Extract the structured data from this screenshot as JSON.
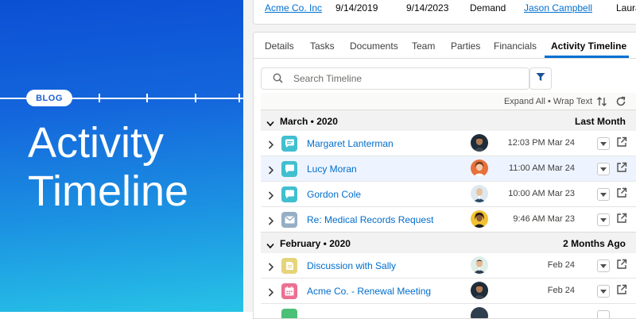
{
  "hero": {
    "tag": "BLOG",
    "title_line1": "Activity",
    "title_line2": "Timeline"
  },
  "record": {
    "account": "Acme Co. Inc",
    "date_opened": "9/14/2019",
    "date_due": "9/14/2023",
    "type": "Demand",
    "owner": "Jason Campbell",
    "last": "Laura"
  },
  "tabs": [
    {
      "label": "Details"
    },
    {
      "label": "Tasks"
    },
    {
      "label": "Documents"
    },
    {
      "label": "Team"
    },
    {
      "label": "Parties"
    },
    {
      "label": "Financials"
    },
    {
      "label": "Activity Timeline",
      "active": true
    }
  ],
  "search": {
    "placeholder": "Search Timeline"
  },
  "toolbar": {
    "expand_wrap": "Expand All • Wrap Text"
  },
  "sections": [
    {
      "label": "March • 2020",
      "right": "Last Month",
      "items": [
        {
          "subject": "Margaret Lanterman",
          "date": "12:03 PM Mar 24",
          "icon": "chat-icon",
          "color": "#40bfcf"
        },
        {
          "subject": "Lucy Moran",
          "date": "11:00 AM Mar 24",
          "icon": "chat-icon",
          "color": "#40bfcf"
        },
        {
          "subject": "Gordon Cole",
          "date": "10:00 AM Mar 23",
          "icon": "chat-icon",
          "color": "#40bfcf"
        },
        {
          "subject": "Re: Medical Records Request",
          "date": "9:46 AM Mar 23",
          "icon": "email-icon",
          "color": "#95aec5"
        }
      ]
    },
    {
      "label": "February • 2020",
      "right": "2 Months Ago",
      "items": [
        {
          "subject": "Discussion with Sally",
          "date": "Feb 24",
          "icon": "note-icon",
          "color": "#e6d478"
        },
        {
          "subject": "Acme Co. - Renewal Meeting",
          "date": "Feb 24",
          "icon": "calendar-icon",
          "color": "#eb7092"
        }
      ]
    }
  ],
  "colors": {
    "accent": "#0070d2",
    "link": "#006dcc",
    "hero_top": "#0b50d4",
    "hero_bottom": "#27c2e6"
  }
}
